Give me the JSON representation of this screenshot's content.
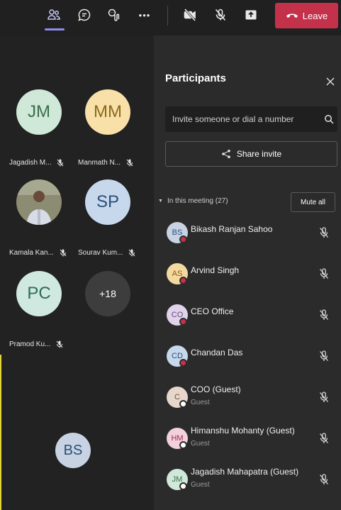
{
  "toolbar": {
    "leave_label": "Leave",
    "more_label": "•••"
  },
  "gallery": {
    "tiles": [
      {
        "initials": "JM",
        "name": "Jagadish M...",
        "bg": "#cfe8d8",
        "fg": "#3b6e4b"
      },
      {
        "initials": "MM",
        "name": "Manmath N...",
        "bg": "#f8e0a8",
        "fg": "#8a6a1a"
      },
      {
        "initials": "",
        "name": "Kamala Kan...",
        "bg": "#8c8c72",
        "fg": "#ffffff"
      },
      {
        "initials": "SP",
        "name": "Sourav Kum...",
        "bg": "#c7d8ec",
        "fg": "#2b4f76"
      },
      {
        "initials": "PC",
        "name": "Pramod Ku...",
        "bg": "#cfe8e0",
        "fg": "#2f6b5a"
      },
      {
        "initials": "+18",
        "name": "",
        "bg": "#3d3d3d",
        "fg": "#ffffff"
      }
    ],
    "self_initials": "BS"
  },
  "panel": {
    "title": "Participants",
    "search_placeholder": "Invite someone or dial a number",
    "share_label": "Share invite",
    "section_label": "In this meeting (27)",
    "mute_all_label": "Mute all",
    "participants": [
      {
        "initials": "BS",
        "name": "Bikash Ranjan Sahoo",
        "sub": "",
        "bg": "#c7d3e2",
        "fg": "#2b4f76",
        "status": "#c4314b"
      },
      {
        "initials": "AS",
        "name": "Arvind Singh",
        "sub": "",
        "bg": "#f3d9a0",
        "fg": "#8a5a10",
        "status": "#c4314b"
      },
      {
        "initials": "CO",
        "name": "CEO Office",
        "sub": "",
        "bg": "#e0d4ea",
        "fg": "#6b3f82",
        "status": "#c4314b"
      },
      {
        "initials": "CD",
        "name": "Chandan Das",
        "sub": "",
        "bg": "#c7d8ec",
        "fg": "#2b4f76",
        "status": "#c4314b"
      },
      {
        "initials": "C",
        "name": "COO (Guest)",
        "sub": "Guest",
        "bg": "#e6d6cc",
        "fg": "#7a4e34",
        "status": "#ffffff"
      },
      {
        "initials": "HM",
        "name": "Himanshu Mohanty (Guest)",
        "sub": "Guest",
        "bg": "#f2d0dc",
        "fg": "#a02a55",
        "status": "#ffffff"
      },
      {
        "initials": "JM",
        "name": "Jagadish Mahapatra (Guest)",
        "sub": "Guest",
        "bg": "#cfe8d8",
        "fg": "#3b6e4b",
        "status": "#ffffff"
      }
    ]
  },
  "colors": {
    "accent": "#8b8cf2",
    "leave": "#c4314b",
    "background": "#1b1b1b",
    "panel": "#2b2b2b"
  }
}
